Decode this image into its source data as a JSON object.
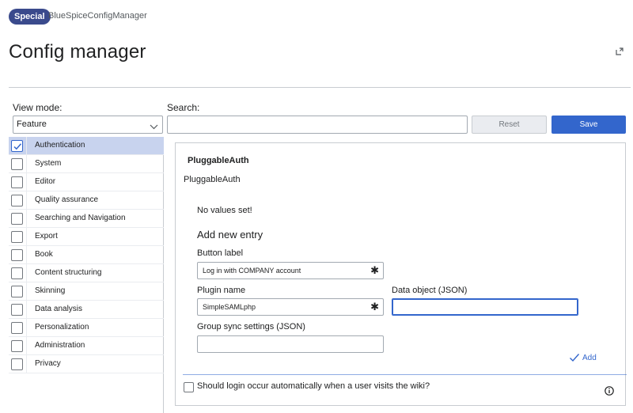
{
  "header": {
    "badge": "Special",
    "breadcrumb": "BlueSpiceConfigManager",
    "title": "Config manager"
  },
  "toolbar": {
    "view_mode_label": "View mode:",
    "view_mode_value": "Feature",
    "search_label": "Search:",
    "search_value": "",
    "reset_label": "Reset",
    "save_label": "Save"
  },
  "categories": [
    {
      "label": "Authentication",
      "checked": true
    },
    {
      "label": "System",
      "checked": false
    },
    {
      "label": "Editor",
      "checked": false
    },
    {
      "label": "Quality assurance",
      "checked": false
    },
    {
      "label": "Searching and Navigation",
      "checked": false
    },
    {
      "label": "Export",
      "checked": false
    },
    {
      "label": "Book",
      "checked": false
    },
    {
      "label": "Content structuring",
      "checked": false
    },
    {
      "label": "Skinning",
      "checked": false
    },
    {
      "label": "Data analysis",
      "checked": false
    },
    {
      "label": "Personalization",
      "checked": false
    },
    {
      "label": "Administration",
      "checked": false
    },
    {
      "label": "Privacy",
      "checked": false
    }
  ],
  "panel": {
    "group_heading": "PluggableAuth",
    "group_subheading": "PluggableAuth",
    "no_values": "No values set!",
    "add_new_entry": "Add new entry",
    "button_label_label": "Button label",
    "button_label_value": "Log in with COMPANY account",
    "plugin_name_label": "Plugin name",
    "plugin_name_value": "SimpleSAMLphp",
    "data_object_label": "Data object (JSON)",
    "data_object_value": "",
    "group_sync_label": "Group sync settings (JSON)",
    "group_sync_value": "",
    "add_label": "Add",
    "auto_login_label": "Should login occur automatically when a user visits the wiki?"
  },
  "colors": {
    "accent": "#3366cc",
    "badge": "#3a4a8c",
    "active_row": "#c8d3ee"
  },
  "icons": {
    "expand": "expand-icon",
    "chevron": "chevron-down-icon",
    "check": "check-icon",
    "required": "required-asterisk-icon",
    "info": "info-icon"
  }
}
